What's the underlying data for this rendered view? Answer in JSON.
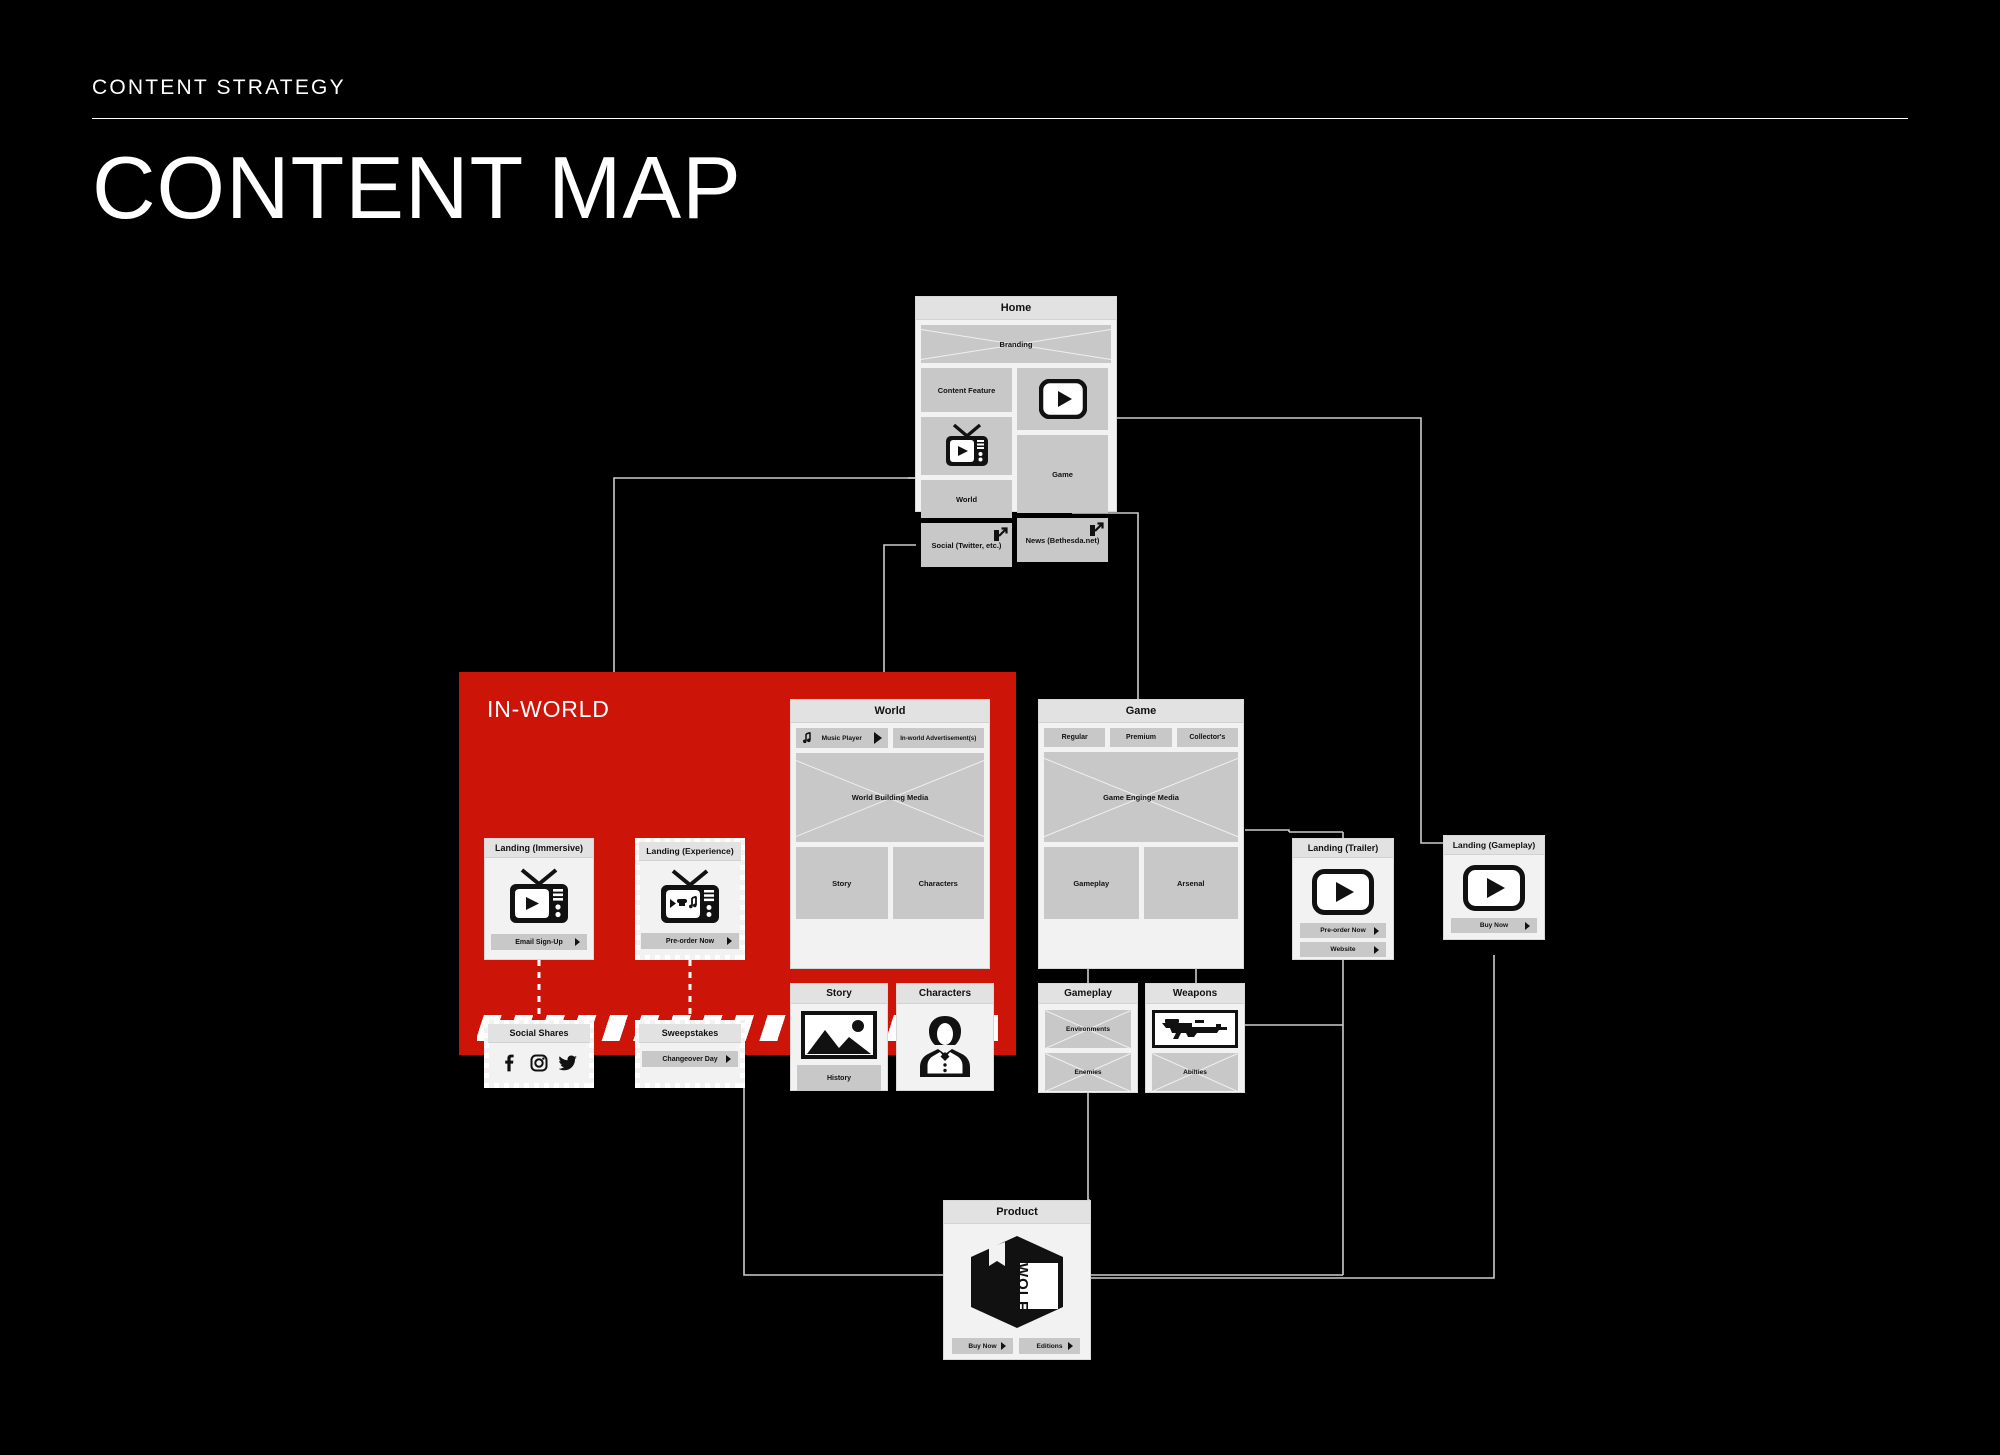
{
  "header": {
    "eyebrow": "CONTENT STRATEGY",
    "title": "CONTENT MAP"
  },
  "colors": {
    "background": "#000000",
    "accent_red": "#CC1409",
    "card_bg": "#f2f2f2",
    "card_title_bg": "#e2e2e2",
    "tile_bg": "#c8c8c8",
    "connector": "#cccccc",
    "text": "#111111"
  },
  "inworld": {
    "label": "IN-WORLD"
  },
  "cards": {
    "home": {
      "title": "Home",
      "tiles": {
        "branding": "Branding",
        "content_feature": "Content Feature",
        "tv_media": "tv-play-icon",
        "world": "World",
        "social": "Social (Twitter, etc.)",
        "video_play": "play-button-icon",
        "game": "Game",
        "news": "News (Bethesda.net)"
      }
    },
    "landing_immersive": {
      "title": "Landing (Immersive)",
      "media": "tv-play-icon",
      "button": "Email Sign-Up"
    },
    "landing_experience": {
      "title": "Landing (Experience)",
      "media": "tv-play-puzzle-music-icon",
      "button": "Pre-order Now"
    },
    "social_shares": {
      "title": "Social Shares",
      "icons": [
        "facebook-icon",
        "instagram-icon",
        "twitter-icon"
      ]
    },
    "sweepstakes": {
      "title": "Sweepstakes",
      "button": "Changeover Day"
    },
    "world": {
      "title": "World",
      "music_player": "Music Player",
      "advertisement": "In-world Advertisement(s)",
      "media": "World Building Media",
      "story": "Story",
      "characters": "Characters"
    },
    "story": {
      "title": "Story",
      "media": "image-placeholder-icon",
      "button": "History"
    },
    "characters": {
      "title": "Characters",
      "media": "person-portrait-icon"
    },
    "game": {
      "title": "Game",
      "editions": [
        "Regular",
        "Premium",
        "Collector's"
      ],
      "media": "Game Enginge Media",
      "gameplay": "Gameplay",
      "arsenal": "Arsenal"
    },
    "gameplay": {
      "title": "Gameplay",
      "environments": "Environments",
      "enemies": "Enemies"
    },
    "weapons": {
      "title": "Weapons",
      "media": "rifle-icon",
      "abilities": "Abilties"
    },
    "landing_trailer": {
      "title": "Landing (Trailer)",
      "media": "play-button-icon",
      "buttons": [
        "Pre-order Now",
        "Website"
      ]
    },
    "landing_gameplay": {
      "title": "Landing (Gameplay)",
      "media": "play-button-icon",
      "button": "Buy Now"
    },
    "product": {
      "title": "Product",
      "media": "box-package-icon",
      "brand": "WOLF",
      "buttons": [
        "Buy Now",
        "Editions"
      ]
    }
  }
}
